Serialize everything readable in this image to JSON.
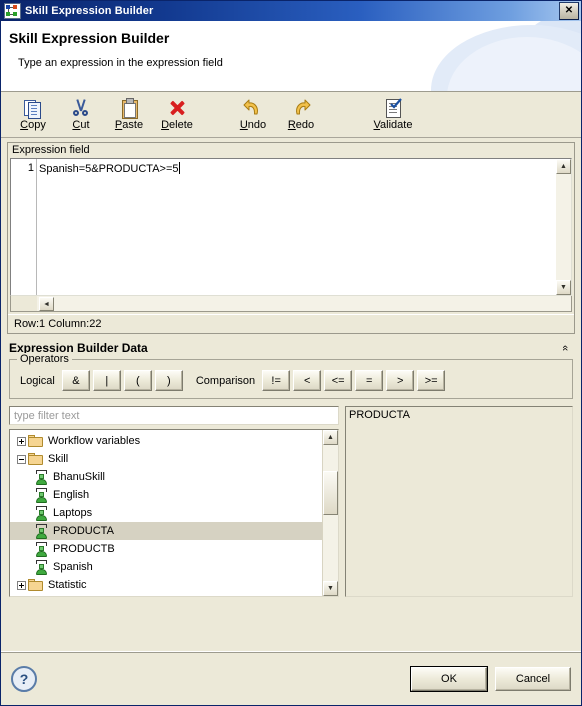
{
  "window": {
    "title": "Skill Expression Builder",
    "icon": "skill-diagram-icon",
    "close_label": "✕"
  },
  "banner": {
    "title": "Skill Expression Builder",
    "subtitle": "Type an expression in the expression field"
  },
  "toolbar": {
    "items": [
      {
        "id": "copy",
        "label_pre": "",
        "mnemonic": "C",
        "label_post": "opy",
        "icon": "copy-icon"
      },
      {
        "id": "cut",
        "label_pre": "",
        "mnemonic": "C",
        "label_post": "ut",
        "icon": "cut-icon"
      },
      {
        "id": "paste",
        "label_pre": "",
        "mnemonic": "P",
        "label_post": "aste",
        "icon": "paste-icon"
      },
      {
        "id": "delete",
        "label_pre": "",
        "mnemonic": "D",
        "label_post": "elete",
        "icon": "delete-icon"
      },
      {
        "id": "undo",
        "label_pre": "",
        "mnemonic": "U",
        "label_post": "ndo",
        "icon": "undo-arrow-icon"
      },
      {
        "id": "redo",
        "label_pre": "",
        "mnemonic": "R",
        "label_post": "edo",
        "icon": "redo-arrow-icon"
      },
      {
        "id": "validate",
        "label_pre": "",
        "mnemonic": "V",
        "label_post": "alidate",
        "icon": "validate-icon"
      }
    ],
    "copy_label": "Copy",
    "cut_label": "Cut",
    "paste_label": "Paste",
    "delete_label": "Delete",
    "undo_label": "Undo",
    "redo_label": "Redo",
    "validate_label": "Validate"
  },
  "expression": {
    "group_label": "Expression field",
    "line_number": "1",
    "text": "Spanish=5&PRODUCTA>=5",
    "status": "Row:1 Column:22",
    "scroll_up": "▲",
    "scroll_down": "▼",
    "scroll_left": "◄"
  },
  "section": {
    "title": "Expression Builder Data",
    "collapse_icon": "«"
  },
  "operators": {
    "legend": "Operators",
    "logical_label": "Logical",
    "logical": [
      "&",
      "|",
      "(",
      ")"
    ],
    "comparison_label": "Comparison",
    "comparison": [
      "!=",
      "<",
      "<=",
      "=",
      ">",
      ">="
    ]
  },
  "filter": {
    "placeholder": "type filter text",
    "value": ""
  },
  "tree": {
    "nodes": [
      {
        "label": "Workflow variables",
        "type": "folder",
        "state": "collapsed",
        "depth": 0,
        "selected": false
      },
      {
        "label": "Skill",
        "type": "folder",
        "state": "expanded",
        "depth": 0,
        "selected": false
      },
      {
        "label": "BhanuSkill",
        "type": "skill",
        "state": "leaf",
        "depth": 1,
        "selected": false
      },
      {
        "label": "English",
        "type": "skill",
        "state": "leaf",
        "depth": 1,
        "selected": false
      },
      {
        "label": "Laptops",
        "type": "skill",
        "state": "leaf",
        "depth": 1,
        "selected": false
      },
      {
        "label": "PRODUCTA",
        "type": "skill",
        "state": "leaf",
        "depth": 1,
        "selected": true
      },
      {
        "label": "PRODUCTB",
        "type": "skill",
        "state": "leaf",
        "depth": 1,
        "selected": false
      },
      {
        "label": "Spanish",
        "type": "skill",
        "state": "leaf",
        "depth": 1,
        "selected": false
      },
      {
        "label": "Statistic",
        "type": "folder",
        "state": "collapsed",
        "depth": 0,
        "selected": false
      }
    ],
    "scroll_up": "▲",
    "scroll_down": "▼"
  },
  "details": {
    "text": "PRODUCTA"
  },
  "footer": {
    "help_label": "?",
    "ok_label": "OK",
    "cancel_label": "Cancel"
  },
  "colors": {
    "titlebar_start": "#0a246a",
    "titlebar_end": "#a8c8ef",
    "dialog_bg": "#ece9d8",
    "selection": "#d6d2c2",
    "folder": "#f6d592",
    "skill_green": "#3faa3f",
    "delete_red": "#d81f1f",
    "undo_yellow": "#f2c14b"
  }
}
